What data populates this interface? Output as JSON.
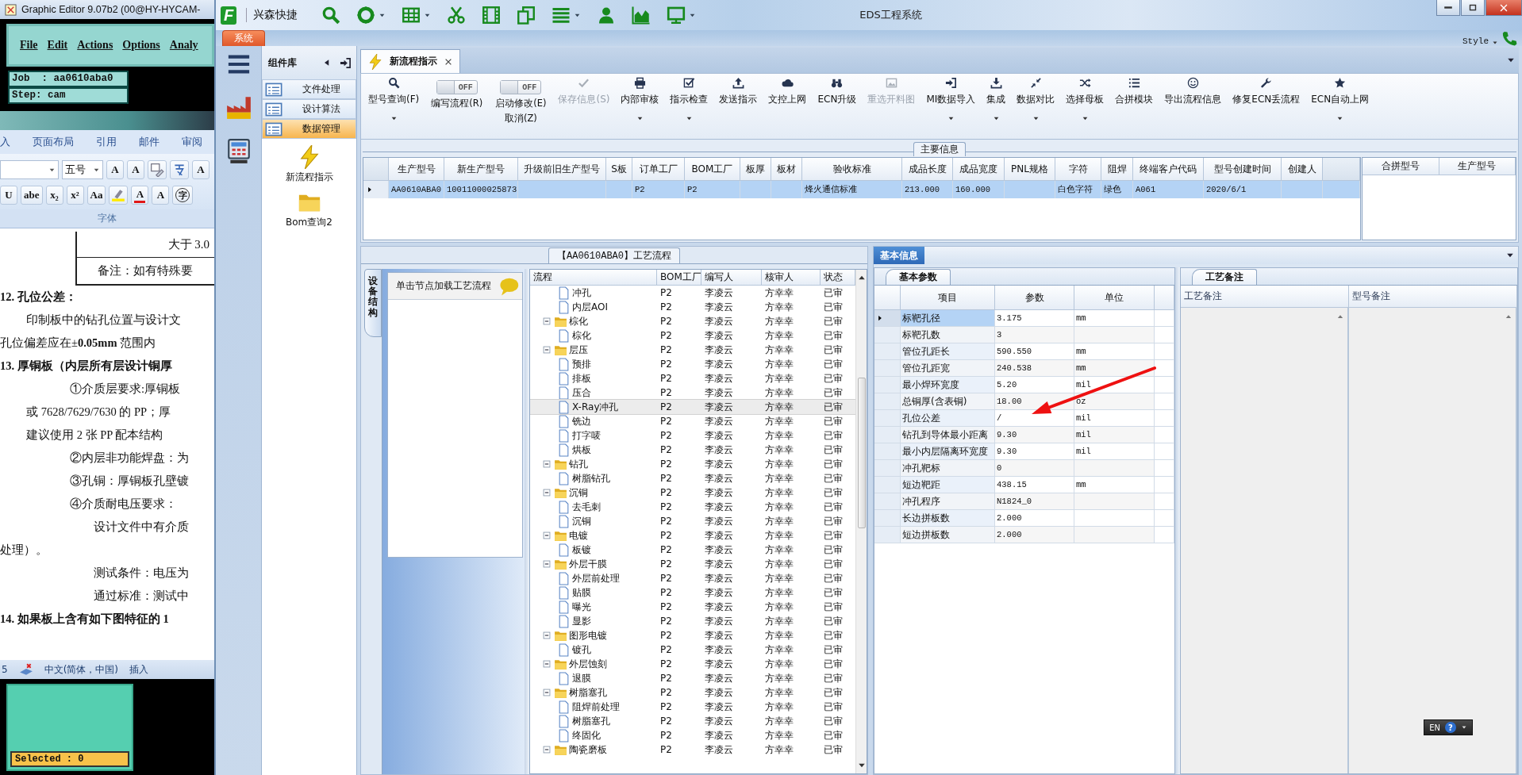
{
  "graphic_editor": {
    "title": "Graphic Editor 9.07b2 (00@HY-HYCAM-",
    "menu": [
      "File",
      "Edit",
      "Actions",
      "Options",
      "Analy"
    ],
    "info_lines": [
      "Job  : aa0610aba0",
      "Step: cam"
    ],
    "selection": "Selected : 0"
  },
  "word": {
    "tabs": [
      "入",
      "页面布局",
      "引用",
      "邮件",
      "审阅"
    ],
    "font_size": "五号",
    "tool_rows": [
      [
        {
          "kind": "text",
          "text": "A"
        },
        {
          "kind": "text",
          "text": "A"
        },
        {
          "kind": "icon"
        },
        {
          "kind": "icon"
        },
        {
          "kind": "text",
          "text": "A"
        }
      ],
      [
        {
          "kind": "text",
          "text": "U"
        },
        {
          "kind": "text",
          "text": "abe"
        },
        {
          "kind": "text",
          "text": "x₂"
        },
        {
          "kind": "text",
          "text": "x²"
        },
        {
          "kind": "text",
          "text": "Aa"
        },
        {
          "kind": "icon"
        },
        {
          "kind": "text",
          "text": "A",
          "color": "#e01818"
        },
        {
          "kind": "text",
          "text": "A"
        },
        {
          "kind": "circled",
          "text": "字"
        }
      ]
    ],
    "group_label": "字体",
    "table_rows": [
      "大于 3.0",
      "备注：如有特殊要"
    ],
    "paragraphs": [
      {
        "kind": "heading",
        "text": "12. 孔位公差："
      },
      {
        "kind": "body",
        "text": "印制板中的钻孔位置与设计文"
      },
      {
        "kind": "plain",
        "text": "孔位偏差应在±**0.05mm** 范围内"
      },
      {
        "kind": "heading",
        "text": "13. **厚铜板**（内层所有层设计铜厚"
      },
      {
        "kind": "item",
        "text": "①介质层要求:厚铜板"
      },
      {
        "kind": "body",
        "text": "或 7628/7629/7630 的 PP；厚"
      },
      {
        "kind": "body",
        "text": "建议使用 2 张 PP 配本结构"
      },
      {
        "kind": "item",
        "text": "②内层非功能焊盘：为"
      },
      {
        "kind": "item",
        "text": "③孔铜：厚铜板孔壁镀"
      },
      {
        "kind": "item",
        "text": "④介质耐电压要求："
      },
      {
        "kind": "note",
        "text": "设计文件中有介质"
      },
      {
        "kind": "plain",
        "text": "处理）。"
      },
      {
        "kind": "note",
        "text": "测试条件：电压为"
      },
      {
        "kind": "note",
        "text": "通过标准：测试中"
      },
      {
        "kind": "heading",
        "text": "14. 如果板上含有如下图特征的 1"
      }
    ],
    "status_bar": [
      "5",
      "中文(简体，中国)",
      "插入"
    ]
  },
  "eds": {
    "logo": "F",
    "brand": "兴森快捷",
    "title": "EDS工程系统",
    "system_tab": "系统",
    "style_menu": "Style",
    "library": {
      "title": "组件库",
      "items": [
        {
          "label": "文件处理",
          "selected": false
        },
        {
          "label": "设计算法",
          "selected": false
        },
        {
          "label": "数据管理",
          "selected": true
        }
      ],
      "tools": [
        "新流程指示",
        "Bom查询2"
      ]
    },
    "doc_tab": {
      "label": "新流程指示",
      "selected": true
    },
    "ribbon": [
      {
        "kind": "button",
        "label": "型号查询(F)",
        "dropdown": true,
        "disabled": false
      },
      {
        "kind": "toggle",
        "label": "编写流程(R)",
        "switch_text": "OFF",
        "on": false
      },
      {
        "kind": "toggle",
        "label": "启动修改(E)",
        "sublabel": "取消(Z)",
        "switch_text": "OFF",
        "on": false
      },
      {
        "kind": "button",
        "label": "保存信息(S)",
        "dropdown": false,
        "disabled": true
      },
      {
        "kind": "button",
        "label": "内部审核",
        "dropdown": true,
        "disabled": false
      },
      {
        "kind": "button",
        "label": "指示检查",
        "dropdown": true,
        "disabled": false
      },
      {
        "kind": "button",
        "label": "发送指示",
        "dropdown": false,
        "disabled": false
      },
      {
        "kind": "button",
        "label": "文控上网",
        "dropdown": false,
        "disabled": false
      },
      {
        "kind": "button",
        "label": "ECN升级",
        "dropdown": false,
        "disabled": false
      },
      {
        "kind": "button",
        "label": "重选开料图",
        "dropdown": false,
        "disabled": true
      },
      {
        "kind": "button",
        "label": "MI数据导入",
        "dropdown": true,
        "disabled": false
      },
      {
        "kind": "button",
        "label": "集成",
        "dropdown": true,
        "disabled": false
      },
      {
        "kind": "button",
        "label": "数据对比",
        "dropdown": true,
        "disabled": false
      },
      {
        "kind": "button",
        "label": "选择母板",
        "dropdown": true,
        "disabled": false
      },
      {
        "kind": "button",
        "label": "合拼模块",
        "dropdown": false,
        "disabled": false
      },
      {
        "kind": "button",
        "label": "导出流程信息",
        "dropdown": false,
        "disabled": false
      },
      {
        "kind": "button",
        "label": "修复ECN丢流程",
        "dropdown": false,
        "disabled": false
      },
      {
        "kind": "button",
        "label": "ECN自动上网",
        "dropdown": true,
        "disabled": false
      }
    ],
    "main_info": {
      "title": "主要信息",
      "columns": [
        "生产型号",
        "新生产型号",
        "升级前旧生产型号",
        "S板",
        "订单工厂",
        "BOM工厂",
        "板厚",
        "板材",
        "验收标准",
        "成品长度",
        "成品宽度",
        "PNL规格",
        "字符",
        "阻焊",
        "终端客户代码",
        "型号创建时间",
        "创建人"
      ],
      "rows": [
        {
          "selected": true,
          "cells": [
            "AA0610ABA0",
            "10011000025873",
            null,
            null,
            "P2",
            "P2",
            null,
            null,
            "烽火通信标准",
            "213.000",
            "160.000",
            null,
            "白色字符",
            "绿色",
            "A061",
            "2020/6/1",
            null
          ]
        }
      ],
      "side_columns": [
        "合拼型号",
        "生产型号"
      ]
    },
    "process_tree": {
      "title": "【AA0610ABA0】工艺流程",
      "side_tab": "设备结构",
      "hint": "单击节点加载工艺流程",
      "columns": [
        "流程",
        "BOM工厂",
        "编写人",
        "核审人",
        "状态"
      ],
      "rows": [
        {
          "children": [
            {
              "name": "冲孔",
              "bom": "P2",
              "writer": "李凌云",
              "reviewer": "方幸幸",
              "status": "已审",
              "selected": false
            },
            {
              "name": "内层AOI",
              "bom": "P2",
              "writer": "李凌云",
              "reviewer": "方幸幸",
              "status": "已审",
              "selected": false
            }
          ]
        },
        {
          "name": "棕化",
          "bom": "P2",
          "writer": "李凌云",
          "reviewer": "方幸幸",
          "status": "已审",
          "selected": false,
          "expanded": true,
          "children": [
            {
              "name": "棕化",
              "bom": "P2",
              "writer": "李凌云",
              "reviewer": "方幸幸",
              "status": "已审",
              "selected": false
            }
          ]
        },
        {
          "name": "层压",
          "bom": "P2",
          "writer": "李凌云",
          "reviewer": "方幸幸",
          "status": "已审",
          "selected": false,
          "expanded": true,
          "children": [
            {
              "name": "预排",
              "bom": "P2",
              "writer": "李凌云",
              "reviewer": "方幸幸",
              "status": "已审",
              "selected": false
            },
            {
              "name": "排板",
              "bom": "P2",
              "writer": "李凌云",
              "reviewer": "方幸幸",
              "status": "已审",
              "selected": false
            },
            {
              "name": "压合",
              "bom": "P2",
              "writer": "李凌云",
              "reviewer": "方幸幸",
              "status": "已审",
              "selected": false
            },
            {
              "name": "X-Ray冲孔",
              "bom": "P2",
              "writer": "李凌云",
              "reviewer": "方幸幸",
              "status": "已审",
              "selected": true
            },
            {
              "name": "铣边",
              "bom": "P2",
              "writer": "李凌云",
              "reviewer": "方幸幸",
              "status": "已审",
              "selected": false
            },
            {
              "name": "打字唛",
              "bom": "P2",
              "writer": "李凌云",
              "reviewer": "方幸幸",
              "status": "已审",
              "selected": false
            },
            {
              "name": "烘板",
              "bom": "P2",
              "writer": "李凌云",
              "reviewer": "方幸幸",
              "status": "已审",
              "selected": false
            }
          ]
        },
        {
          "name": "钻孔",
          "bom": "P2",
          "writer": "李凌云",
          "reviewer": "方幸幸",
          "status": "已审",
          "selected": false,
          "expanded": true,
          "children": [
            {
              "name": "树脂钻孔",
              "bom": "P2",
              "writer": "李凌云",
              "reviewer": "方幸幸",
              "status": "已审",
              "selected": false
            }
          ]
        },
        {
          "name": "沉铜",
          "bom": "P2",
          "writer": "李凌云",
          "reviewer": "方幸幸",
          "status": "已审",
          "selected": false,
          "expanded": true,
          "children": [
            {
              "name": "去毛刺",
              "bom": "P2",
              "writer": "李凌云",
              "reviewer": "方幸幸",
              "status": "已审",
              "selected": false
            },
            {
              "name": "沉铜",
              "bom": "P2",
              "writer": "李凌云",
              "reviewer": "方幸幸",
              "status": "已审",
              "selected": false
            }
          ]
        },
        {
          "name": "电镀",
          "bom": "P2",
          "writer": "李凌云",
          "reviewer": "方幸幸",
          "status": "已审",
          "selected": false,
          "expanded": true,
          "children": [
            {
              "name": "板镀",
              "bom": "P2",
              "writer": "李凌云",
              "reviewer": "方幸幸",
              "status": "已审",
              "selected": false
            }
          ]
        },
        {
          "name": "外层干膜",
          "bom": "P2",
          "writer": "李凌云",
          "reviewer": "方幸幸",
          "status": "已审",
          "selected": false,
          "expanded": true,
          "children": [
            {
              "name": "外层前处理",
              "bom": "P2",
              "writer": "李凌云",
              "reviewer": "方幸幸",
              "status": "已审",
              "selected": false
            },
            {
              "name": "贴膜",
              "bom": "P2",
              "writer": "李凌云",
              "reviewer": "方幸幸",
              "status": "已审",
              "selected": false
            },
            {
              "name": "曝光",
              "bom": "P2",
              "writer": "李凌云",
              "reviewer": "方幸幸",
              "status": "已审",
              "selected": false
            },
            {
              "name": "显影",
              "bom": "P2",
              "writer": "李凌云",
              "reviewer": "方幸幸",
              "status": "已审",
              "selected": false
            }
          ]
        },
        {
          "name": "图形电镀",
          "bom": "P2",
          "writer": "李凌云",
          "reviewer": "方幸幸",
          "status": "已审",
          "selected": false,
          "expanded": true,
          "children": [
            {
              "name": "镀孔",
              "bom": "P2",
              "writer": "李凌云",
              "reviewer": "方幸幸",
              "status": "已审",
              "selected": false
            }
          ]
        },
        {
          "name": "外层蚀刻",
          "bom": "P2",
          "writer": "李凌云",
          "reviewer": "方幸幸",
          "status": "已审",
          "selected": false,
          "expanded": true,
          "children": [
            {
              "name": "退膜",
              "bom": "P2",
              "writer": "李凌云",
              "reviewer": "方幸幸",
              "status": "已审",
              "selected": false
            }
          ]
        },
        {
          "name": "树脂塞孔",
          "bom": "P2",
          "writer": "李凌云",
          "reviewer": "方幸幸",
          "status": "已审",
          "selected": false,
          "expanded": true,
          "children": [
            {
              "name": "阻焊前处理",
              "bom": "P2",
              "writer": "李凌云",
              "reviewer": "方幸幸",
              "status": "已审",
              "selected": false
            },
            {
              "name": "树脂塞孔",
              "bom": "P2",
              "writer": "李凌云",
              "reviewer": "方幸幸",
              "status": "已审",
              "selected": false
            },
            {
              "name": "终固化",
              "bom": "P2",
              "writer": "李凌云",
              "reviewer": "方幸幸",
              "status": "已审",
              "selected": false
            }
          ]
        },
        {
          "name": "陶瓷磨板",
          "bom": "P2",
          "writer": "李凌云",
          "reviewer": "方幸幸",
          "status": "已审",
          "selected": false,
          "expanded": true
        }
      ]
    },
    "detail": {
      "tab": "基本信息",
      "params": {
        "tab": "基本参数",
        "columns": [
          "项目",
          "参数",
          "单位"
        ],
        "rows": [
          {
            "item": "标靶孔径",
            "value": "3.175",
            "unit": "mm",
            "selected": true
          },
          {
            "item": "标靶孔数",
            "value": "3",
            "selected": false
          },
          {
            "item": "管位孔距长",
            "value": "590.550",
            "unit": "mm",
            "selected": false
          },
          {
            "item": "管位孔距宽",
            "value": "240.538",
            "unit": "mm",
            "selected": false
          },
          {
            "item": "最小焊环宽度",
            "value": "5.20",
            "unit": "mil",
            "selected": false
          },
          {
            "item": "总铜厚(含表铜)",
            "value": "18.00",
            "unit": "oz",
            "selected": false
          },
          {
            "item": "孔位公差",
            "value": "/",
            "unit": "mil",
            "selected": false
          },
          {
            "item": "钻孔到导体最小距离",
            "value": "9.30",
            "unit": "mil",
            "selected": false
          },
          {
            "item": "最小内层隔离环宽度",
            "value": "9.30",
            "unit": "mil",
            "selected": false
          },
          {
            "item": "冲孔靶标",
            "value": "0",
            "selected": false
          },
          {
            "item": "短边靶距",
            "value": "438.15",
            "unit": "mm",
            "selected": false
          },
          {
            "item": "冲孔程序",
            "value": "N1824_0",
            "selected": false
          },
          {
            "item": "长边拼板数",
            "value": "2.000",
            "selected": false
          },
          {
            "item": "短边拼板数",
            "value": "2.000",
            "selected": false
          }
        ]
      },
      "notes": {
        "tab": "工艺备注",
        "columns": [
          "工艺备注",
          "型号备注"
        ]
      }
    },
    "language_bar": {
      "label": "EN",
      "help": "?"
    }
  }
}
